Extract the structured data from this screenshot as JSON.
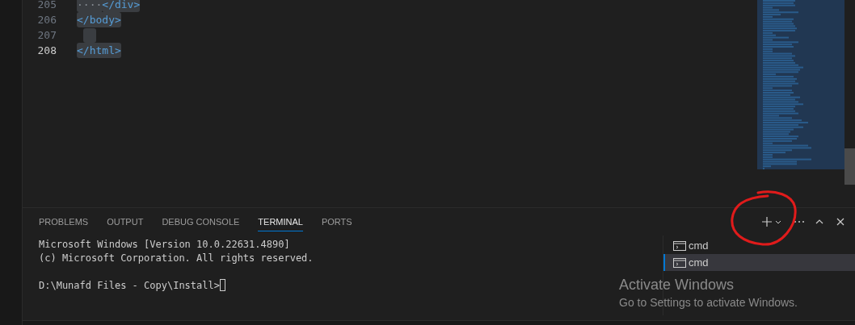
{
  "editor": {
    "lines": [
      {
        "number": "205",
        "indent": "····",
        "code": "</div>",
        "current": false
      },
      {
        "number": "206",
        "code": "</body>",
        "current": false
      },
      {
        "number": "207",
        "current": false
      },
      {
        "number": "208",
        "code": "</html>",
        "current": true
      }
    ]
  },
  "panel": {
    "tabs": [
      {
        "label": "PROBLEMS",
        "selected": false
      },
      {
        "label": "OUTPUT",
        "selected": false
      },
      {
        "label": "DEBUG CONSOLE",
        "selected": false
      },
      {
        "label": "TERMINAL",
        "selected": true
      },
      {
        "label": "PORTS",
        "selected": false
      }
    ],
    "terminal_banner": [
      "Microsoft Windows [Version 10.0.22631.4890]",
      "(c) Microsoft Corporation. All rights reserved."
    ],
    "terminal_prompt": "D:\\Munafd Files - Copy\\Install>",
    "terminals": [
      {
        "label": "cmd",
        "selected": false
      },
      {
        "label": "cmd",
        "selected": true
      }
    ]
  },
  "overlay": {
    "title": "Activate Windows",
    "subtitle": "Go to Settings to activate Windows."
  }
}
